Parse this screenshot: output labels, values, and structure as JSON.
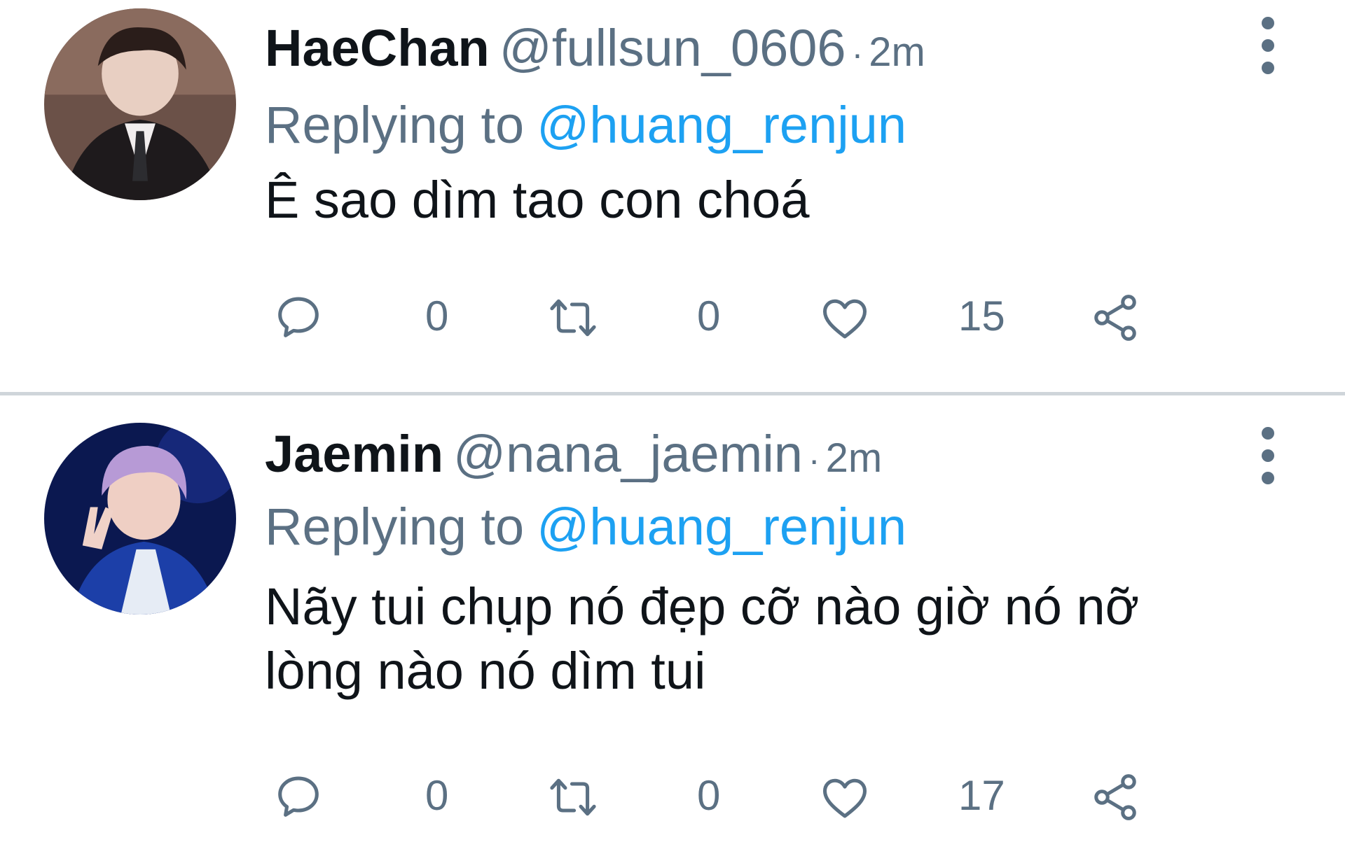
{
  "tweets": [
    {
      "display_name": "HaeChan",
      "handle": "@fullsun_0606",
      "separator": "·",
      "timestamp": "2m",
      "reply_prefix": "Replying to",
      "reply_target": "@huang_renjun",
      "text": "Ê sao dìm tao con choá",
      "counts": {
        "replies": "0",
        "retweets": "0",
        "likes": "15"
      }
    },
    {
      "display_name": "Jaemin",
      "handle": "@nana_jaemin",
      "separator": "·",
      "timestamp": "2m",
      "reply_prefix": "Replying to",
      "reply_target": "@huang_renjun",
      "text": "Nãy tui chụp nó đẹp cỡ nào giờ nó nỡ lòng nào nó dìm tui",
      "counts": {
        "replies": "0",
        "retweets": "0",
        "likes": "17"
      }
    }
  ],
  "icons": {
    "reply": "speech-bubble-icon",
    "retweet": "retweet-arrows-icon",
    "like": "heart-icon",
    "share": "share-nodes-icon",
    "more": "vertical-ellipsis-icon"
  },
  "colors": {
    "link": "#1da1f2",
    "secondary_text": "#5b7083",
    "primary_text": "#0f1419",
    "divider": "#cfd5da"
  }
}
